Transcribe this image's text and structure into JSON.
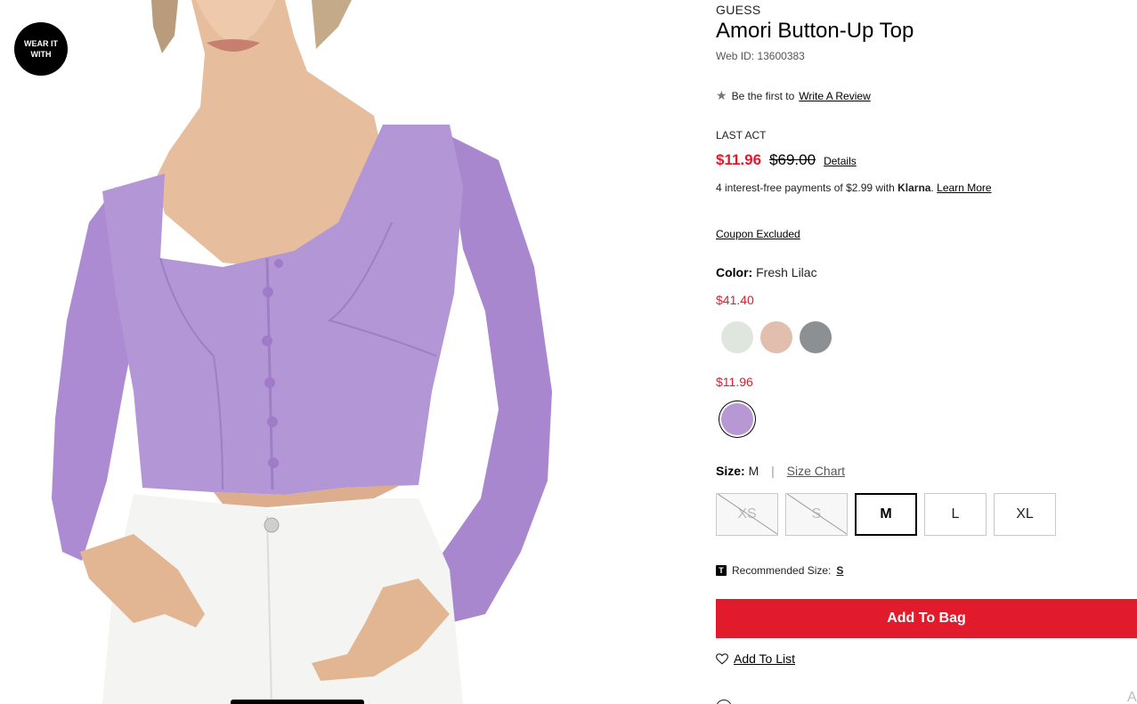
{
  "gallery": {
    "wear_badge": "WEAR IT WITH"
  },
  "product": {
    "brand": "GUESS",
    "title": "Amori Button-Up Top",
    "web_id": "Web ID: 13600383"
  },
  "review": {
    "icon": "star-icon",
    "prefix": "Be the first to",
    "link": "Write A Review"
  },
  "pricing": {
    "badge": "LAST ACT",
    "sale_price": "$11.96",
    "original_price": "$69.00",
    "details_link": "Details",
    "klarna_text": "4 interest-free payments of $2.99 with",
    "klarna_brand": "Klarna",
    "klarna_suffix": ".",
    "klarna_link": "Learn More",
    "coupon": "Coupon Excluded"
  },
  "color": {
    "label": "Color:",
    "selected": "Fresh Lilac",
    "groups": [
      {
        "price": "$41.40",
        "swatches": [
          "#dfe6de",
          "#e2beae",
          "#8d9093"
        ]
      },
      {
        "price": "$11.96",
        "swatches": [
          "#b798d2"
        ]
      }
    ]
  },
  "size": {
    "label": "Size:",
    "selected": "M",
    "divider": "|",
    "chart_link": "Size Chart",
    "options": [
      "XS",
      "S",
      "M",
      "L",
      "XL"
    ],
    "unavailable": [
      "XS",
      "S"
    ],
    "recommended_label": "Recommended Size:",
    "recommended_value": "S",
    "recommended_icon_glyph": "T"
  },
  "actions": {
    "add_to_bag": "Add To Bag",
    "add_to_list": "Add To List"
  },
  "colors": {
    "sale_red": "#e11a2c",
    "lilac": "#b798d2"
  }
}
